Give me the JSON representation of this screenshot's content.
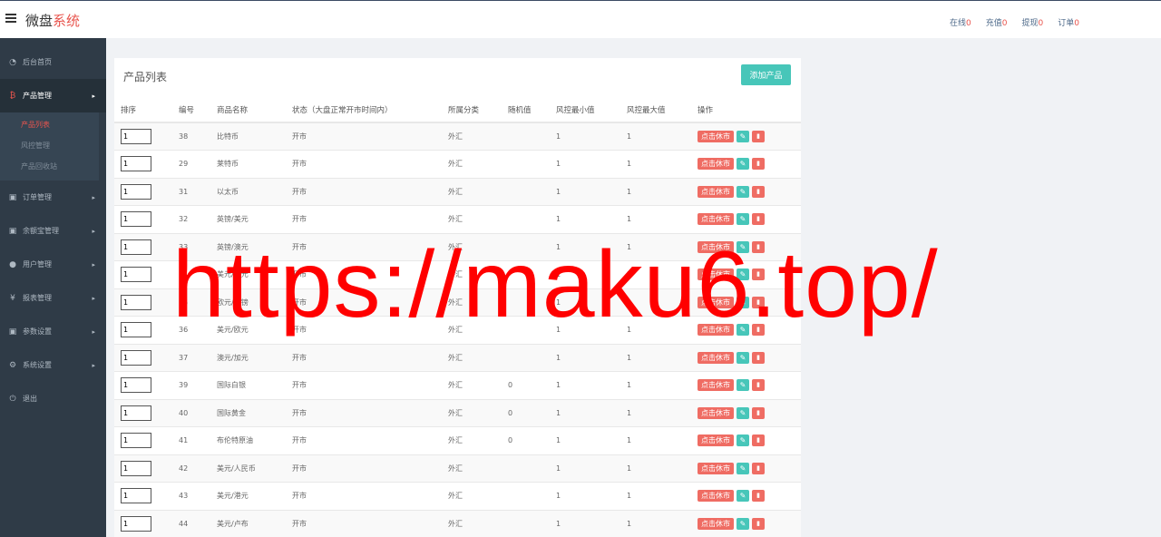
{
  "header": {
    "brand_main": "微盘",
    "brand_accent": "系统",
    "links": [
      {
        "label": "在线",
        "count": "0"
      },
      {
        "label": "充值",
        "count": "0"
      },
      {
        "label": "提现",
        "count": "0"
      },
      {
        "label": "订单",
        "count": "0"
      }
    ]
  },
  "sidebar": {
    "items": [
      {
        "icon": "dashboard-icon",
        "glyph": "◔",
        "label": "后台首页"
      },
      {
        "icon": "bitcoin-icon",
        "glyph": "₿",
        "label": "产品管理",
        "chev": "▸"
      },
      {
        "icon": "orders-icon",
        "glyph": "▣",
        "label": "订单管理",
        "chev": "▸"
      },
      {
        "icon": "balance-icon",
        "glyph": "▣",
        "label": "余额宝管理",
        "chev": "▸"
      },
      {
        "icon": "user-icon",
        "glyph": "●",
        "label": "用户管理",
        "chev": "▸"
      },
      {
        "icon": "yen-icon",
        "glyph": "¥",
        "label": "报表管理",
        "chev": "▸"
      },
      {
        "icon": "params-icon",
        "glyph": "▣",
        "label": "参数设置",
        "chev": "▸"
      },
      {
        "icon": "gears-icon",
        "glyph": "⚙",
        "label": "系统设置",
        "chev": "▸"
      },
      {
        "icon": "power-icon",
        "glyph": "⏻",
        "label": "退出"
      }
    ],
    "sub_items": [
      "产品列表",
      "风控管理",
      "产品回收站"
    ]
  },
  "panel": {
    "title": "产品列表",
    "add_button": "添加产品"
  },
  "table": {
    "headers": [
      "排序",
      "编号",
      "商品名称",
      "状态（大盘正常开市时间内）",
      "所属分类",
      "随机值",
      "风控最小值",
      "风控最大值",
      "操作"
    ],
    "close_label": "点击休市",
    "rows": [
      {
        "sort": "1",
        "id": "38",
        "name": "比特币",
        "status": "开市",
        "category": "外汇",
        "random": "",
        "min": "1",
        "max": "1"
      },
      {
        "sort": "1",
        "id": "29",
        "name": "莱特币",
        "status": "开市",
        "category": "外汇",
        "random": "",
        "min": "1",
        "max": "1"
      },
      {
        "sort": "1",
        "id": "31",
        "name": "以太币",
        "status": "开市",
        "category": "外汇",
        "random": "",
        "min": "1",
        "max": "1"
      },
      {
        "sort": "1",
        "id": "32",
        "name": "英镑/美元",
        "status": "开市",
        "category": "外汇",
        "random": "",
        "min": "1",
        "max": "1"
      },
      {
        "sort": "1",
        "id": "33",
        "name": "英镑/澳元",
        "status": "开市",
        "category": "外汇",
        "random": "",
        "min": "1",
        "max": "1"
      },
      {
        "sort": "1",
        "id": "34",
        "name": "美元/日元",
        "status": "开市",
        "category": "外汇",
        "random": "",
        "min": "1",
        "max": "1"
      },
      {
        "sort": "1",
        "id": "35",
        "name": "欧元/英镑",
        "status": "开市",
        "category": "外汇",
        "random": "",
        "min": "1",
        "max": "1"
      },
      {
        "sort": "1",
        "id": "36",
        "name": "美元/欧元",
        "status": "开市",
        "category": "外汇",
        "random": "",
        "min": "1",
        "max": "1"
      },
      {
        "sort": "1",
        "id": "37",
        "name": "澳元/加元",
        "status": "开市",
        "category": "外汇",
        "random": "",
        "min": "1",
        "max": "1"
      },
      {
        "sort": "1",
        "id": "39",
        "name": "国际白银",
        "status": "开市",
        "category": "外汇",
        "random": "0",
        "min": "1",
        "max": "1"
      },
      {
        "sort": "1",
        "id": "40",
        "name": "国际黄金",
        "status": "开市",
        "category": "外汇",
        "random": "0",
        "min": "1",
        "max": "1"
      },
      {
        "sort": "1",
        "id": "41",
        "name": "布伦特原油",
        "status": "开市",
        "category": "外汇",
        "random": "0",
        "min": "1",
        "max": "1"
      },
      {
        "sort": "1",
        "id": "42",
        "name": "美元/人民币",
        "status": "开市",
        "category": "外汇",
        "random": "",
        "min": "1",
        "max": "1"
      },
      {
        "sort": "1",
        "id": "43",
        "name": "美元/港元",
        "status": "开市",
        "category": "外汇",
        "random": "",
        "min": "1",
        "max": "1"
      },
      {
        "sort": "1",
        "id": "44",
        "name": "美元/卢布",
        "status": "开市",
        "category": "外汇",
        "random": "",
        "min": "1",
        "max": "1"
      }
    ]
  },
  "watermark": "https://maku6.top/"
}
